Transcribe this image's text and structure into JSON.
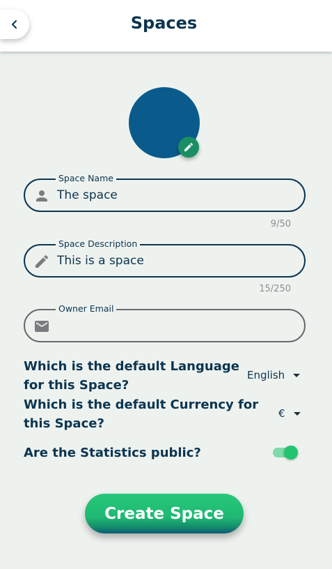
{
  "header": {
    "title": "Spaces",
    "back_icon": "chevron-left-icon"
  },
  "avatar": {
    "color": "#0a5b8c",
    "edit_icon": "pencil-icon",
    "edit_color": "#1a8f63"
  },
  "form": {
    "space_name": {
      "label": "Space Name",
      "value": "The space",
      "icon": "person-icon",
      "counter": "9/50"
    },
    "space_description": {
      "label": "Space Description",
      "value": "This is a space",
      "icon": "pencil-icon",
      "counter": "15/250"
    },
    "owner_email": {
      "label": "Owner Email",
      "value": "",
      "icon": "envelope-icon"
    },
    "language": {
      "question": "Which is the default Language for this Space?",
      "selected": "English"
    },
    "currency": {
      "question": "Which is the default Currency for this Space?",
      "selected": "€"
    },
    "statistics": {
      "question": "Are the Statistics public?",
      "enabled": true
    },
    "submit_label": "Create Space"
  },
  "colors": {
    "primary": "#0b3550",
    "accent": "#22c472",
    "background": "#eef2ef"
  }
}
